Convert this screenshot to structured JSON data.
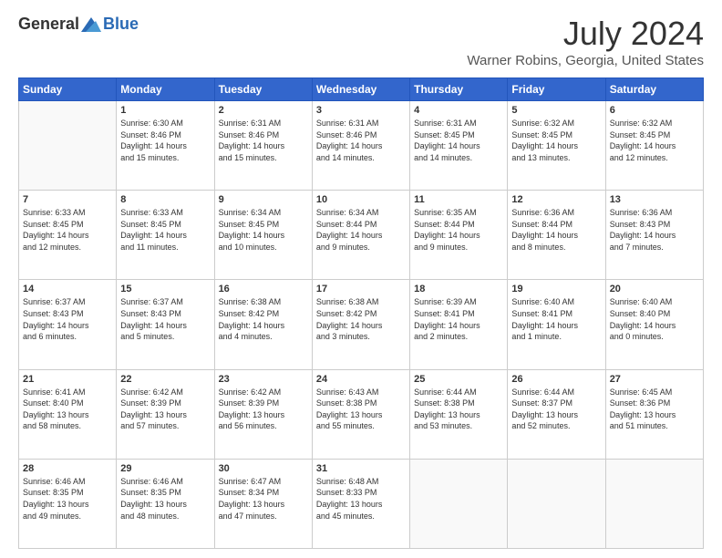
{
  "logo": {
    "general": "General",
    "blue": "Blue"
  },
  "title": "July 2024",
  "location": "Warner Robins, Georgia, United States",
  "days_of_week": [
    "Sunday",
    "Monday",
    "Tuesday",
    "Wednesday",
    "Thursday",
    "Friday",
    "Saturday"
  ],
  "weeks": [
    [
      {
        "day": "",
        "info": ""
      },
      {
        "day": "1",
        "info": "Sunrise: 6:30 AM\nSunset: 8:46 PM\nDaylight: 14 hours\nand 15 minutes."
      },
      {
        "day": "2",
        "info": "Sunrise: 6:31 AM\nSunset: 8:46 PM\nDaylight: 14 hours\nand 15 minutes."
      },
      {
        "day": "3",
        "info": "Sunrise: 6:31 AM\nSunset: 8:46 PM\nDaylight: 14 hours\nand 14 minutes."
      },
      {
        "day": "4",
        "info": "Sunrise: 6:31 AM\nSunset: 8:45 PM\nDaylight: 14 hours\nand 14 minutes."
      },
      {
        "day": "5",
        "info": "Sunrise: 6:32 AM\nSunset: 8:45 PM\nDaylight: 14 hours\nand 13 minutes."
      },
      {
        "day": "6",
        "info": "Sunrise: 6:32 AM\nSunset: 8:45 PM\nDaylight: 14 hours\nand 12 minutes."
      }
    ],
    [
      {
        "day": "7",
        "info": "Sunrise: 6:33 AM\nSunset: 8:45 PM\nDaylight: 14 hours\nand 12 minutes."
      },
      {
        "day": "8",
        "info": "Sunrise: 6:33 AM\nSunset: 8:45 PM\nDaylight: 14 hours\nand 11 minutes."
      },
      {
        "day": "9",
        "info": "Sunrise: 6:34 AM\nSunset: 8:45 PM\nDaylight: 14 hours\nand 10 minutes."
      },
      {
        "day": "10",
        "info": "Sunrise: 6:34 AM\nSunset: 8:44 PM\nDaylight: 14 hours\nand 9 minutes."
      },
      {
        "day": "11",
        "info": "Sunrise: 6:35 AM\nSunset: 8:44 PM\nDaylight: 14 hours\nand 9 minutes."
      },
      {
        "day": "12",
        "info": "Sunrise: 6:36 AM\nSunset: 8:44 PM\nDaylight: 14 hours\nand 8 minutes."
      },
      {
        "day": "13",
        "info": "Sunrise: 6:36 AM\nSunset: 8:43 PM\nDaylight: 14 hours\nand 7 minutes."
      }
    ],
    [
      {
        "day": "14",
        "info": "Sunrise: 6:37 AM\nSunset: 8:43 PM\nDaylight: 14 hours\nand 6 minutes."
      },
      {
        "day": "15",
        "info": "Sunrise: 6:37 AM\nSunset: 8:43 PM\nDaylight: 14 hours\nand 5 minutes."
      },
      {
        "day": "16",
        "info": "Sunrise: 6:38 AM\nSunset: 8:42 PM\nDaylight: 14 hours\nand 4 minutes."
      },
      {
        "day": "17",
        "info": "Sunrise: 6:38 AM\nSunset: 8:42 PM\nDaylight: 14 hours\nand 3 minutes."
      },
      {
        "day": "18",
        "info": "Sunrise: 6:39 AM\nSunset: 8:41 PM\nDaylight: 14 hours\nand 2 minutes."
      },
      {
        "day": "19",
        "info": "Sunrise: 6:40 AM\nSunset: 8:41 PM\nDaylight: 14 hours\nand 1 minute."
      },
      {
        "day": "20",
        "info": "Sunrise: 6:40 AM\nSunset: 8:40 PM\nDaylight: 14 hours\nand 0 minutes."
      }
    ],
    [
      {
        "day": "21",
        "info": "Sunrise: 6:41 AM\nSunset: 8:40 PM\nDaylight: 13 hours\nand 58 minutes."
      },
      {
        "day": "22",
        "info": "Sunrise: 6:42 AM\nSunset: 8:39 PM\nDaylight: 13 hours\nand 57 minutes."
      },
      {
        "day": "23",
        "info": "Sunrise: 6:42 AM\nSunset: 8:39 PM\nDaylight: 13 hours\nand 56 minutes."
      },
      {
        "day": "24",
        "info": "Sunrise: 6:43 AM\nSunset: 8:38 PM\nDaylight: 13 hours\nand 55 minutes."
      },
      {
        "day": "25",
        "info": "Sunrise: 6:44 AM\nSunset: 8:38 PM\nDaylight: 13 hours\nand 53 minutes."
      },
      {
        "day": "26",
        "info": "Sunrise: 6:44 AM\nSunset: 8:37 PM\nDaylight: 13 hours\nand 52 minutes."
      },
      {
        "day": "27",
        "info": "Sunrise: 6:45 AM\nSunset: 8:36 PM\nDaylight: 13 hours\nand 51 minutes."
      }
    ],
    [
      {
        "day": "28",
        "info": "Sunrise: 6:46 AM\nSunset: 8:35 PM\nDaylight: 13 hours\nand 49 minutes."
      },
      {
        "day": "29",
        "info": "Sunrise: 6:46 AM\nSunset: 8:35 PM\nDaylight: 13 hours\nand 48 minutes."
      },
      {
        "day": "30",
        "info": "Sunrise: 6:47 AM\nSunset: 8:34 PM\nDaylight: 13 hours\nand 47 minutes."
      },
      {
        "day": "31",
        "info": "Sunrise: 6:48 AM\nSunset: 8:33 PM\nDaylight: 13 hours\nand 45 minutes."
      },
      {
        "day": "",
        "info": ""
      },
      {
        "day": "",
        "info": ""
      },
      {
        "day": "",
        "info": ""
      }
    ]
  ]
}
